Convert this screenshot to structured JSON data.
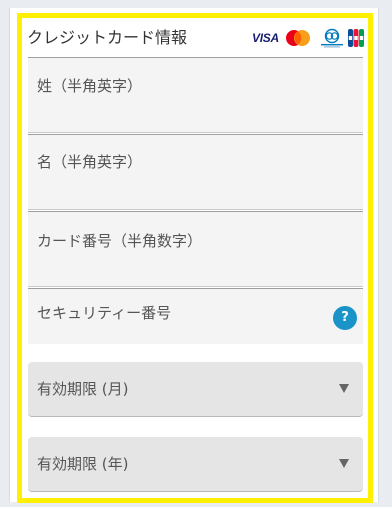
{
  "section": {
    "title": "クレジットカード情報",
    "brands": {
      "visa": "VISA",
      "icons": [
        "mastercard-icon",
        "diners-club-icon",
        "jcb-icon"
      ]
    }
  },
  "fields": {
    "last_name_placeholder": "姓（半角英字）",
    "first_name_placeholder": "名（半角英字）",
    "card_number_placeholder": "カード番号（半角数字）",
    "security_code_placeholder": "セキュリティー番号",
    "help_label": "?"
  },
  "selects": {
    "expiry_month": "有効期限 (月)",
    "expiry_year": "有効期限 (年)"
  },
  "colors": {
    "highlight": "#ffef00",
    "help_icon": "#1a93c9",
    "field_bg": "#f4f4f4",
    "select_bg": "#e5e5e5"
  }
}
